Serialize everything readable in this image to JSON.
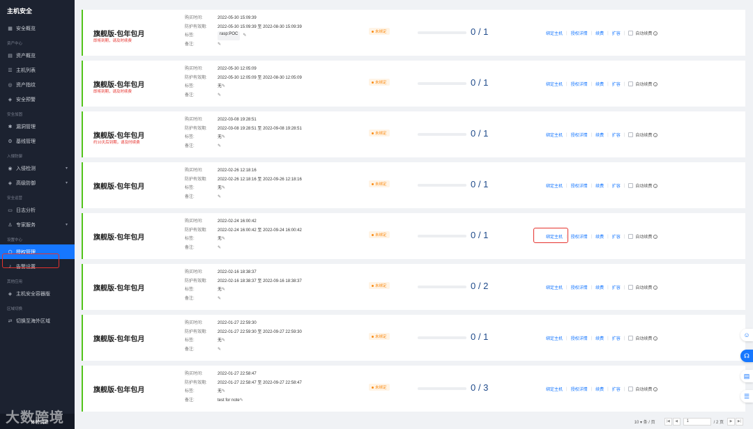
{
  "sidebar": {
    "brand": "主机安全",
    "items": [
      {
        "type": "item",
        "label": "安全概览",
        "icon": "grid-icon"
      },
      {
        "type": "group",
        "label": "资产中心"
      },
      {
        "type": "item",
        "label": "资产概览",
        "icon": "chart-icon"
      },
      {
        "type": "item",
        "label": "主机列表",
        "icon": "list-icon"
      },
      {
        "type": "item",
        "label": "资产指纹",
        "icon": "fingerprint-icon"
      },
      {
        "type": "item",
        "label": "安全预警",
        "icon": "shield-icon"
      },
      {
        "type": "group",
        "label": "安全加固"
      },
      {
        "type": "item",
        "label": "漏洞管理",
        "icon": "bug-icon"
      },
      {
        "type": "item",
        "label": "基线管理",
        "icon": "gear-icon"
      },
      {
        "type": "group",
        "label": "入侵防御"
      },
      {
        "type": "item",
        "label": "入侵检测",
        "icon": "radar-icon",
        "caret": true
      },
      {
        "type": "item",
        "label": "高级防御",
        "icon": "shield-icon",
        "caret": true
      },
      {
        "type": "group",
        "label": "安全运营"
      },
      {
        "type": "item",
        "label": "日志分析",
        "icon": "doc-icon"
      },
      {
        "type": "item",
        "label": "专家服务",
        "icon": "user-icon",
        "caret": true
      },
      {
        "type": "group",
        "label": "设置中心"
      },
      {
        "type": "item",
        "label": "授权管理",
        "icon": "key-icon",
        "active": true
      },
      {
        "type": "item",
        "label": "告警设置",
        "icon": "bell-icon"
      },
      {
        "type": "group",
        "label": "其他应用"
      },
      {
        "type": "item",
        "label": "主机安全容器版",
        "icon": "shield-icon"
      },
      {
        "type": "group",
        "label": "区域切换"
      },
      {
        "type": "item",
        "label": "切换至海外区域",
        "icon": "swap-icon"
      }
    ],
    "bottom_label": "体验调研",
    "watermark": "大数跨境"
  },
  "labels": {
    "purchase_time": "购买时间:",
    "protect_period": "防护有效期:",
    "tag": "标签:",
    "note": "备注:",
    "status": "未绑定",
    "bind_host": "绑定主机",
    "auth_detail": "授权详情",
    "renew": "续费",
    "expand": "扩容",
    "auto_renew": "自动续费",
    "to": "至"
  },
  "cards": [
    {
      "name": "旗舰版-包年包月",
      "warn": "即将到期，请及时续费",
      "purchase": "2022-05-30 15:09:39",
      "start": "2022-05-30 15:09:39",
      "end": "2022-08-30 15:09:39",
      "tag": "rasp:POC",
      "note": "",
      "used": 0,
      "total": 1,
      "count": "0 / 1"
    },
    {
      "name": "旗舰版-包年包月",
      "warn": "即将到期，请及时续费",
      "purchase": "2022-05-30 12:05:09",
      "start": "2022-05-30 12:05:09",
      "end": "2022-08-30 12:05:09",
      "tag": "无",
      "note": "",
      "used": 0,
      "total": 1,
      "count": "0 / 1"
    },
    {
      "name": "旗舰版-包年包月",
      "warn": "约10天后到期，请及时续费",
      "purchase": "2022-03-08 19:28:51",
      "start": "2022-03-08 19:28:51",
      "end": "2022-09-08 19:28:51",
      "tag": "无",
      "note": "",
      "used": 0,
      "total": 1,
      "count": "0 / 1"
    },
    {
      "name": "旗舰版-包年包月",
      "warn": "",
      "purchase": "2022-02-26 12:18:16",
      "start": "2022-02-26 12:18:16",
      "end": "2022-09-26 12:18:16",
      "tag": "无",
      "note": "",
      "used": 0,
      "total": 1,
      "count": "0 / 1"
    },
    {
      "name": "旗舰版-包年包月",
      "warn": "",
      "purchase": "2022-02-24 16:00:42",
      "start": "2022-02-24 16:00:42",
      "end": "2022-09-24 16:00:42",
      "tag": "无",
      "note": "",
      "used": 0,
      "total": 1,
      "count": "0 / 1",
      "highlight": true
    },
    {
      "name": "旗舰版-包年包月",
      "warn": "",
      "purchase": "2022-02-16 18:38:37",
      "start": "2022-02-16 18:38:37",
      "end": "2022-09-16 18:38:37",
      "tag": "无",
      "note": "",
      "used": 0,
      "total": 2,
      "count": "0 / 2"
    },
    {
      "name": "旗舰版-包年包月",
      "warn": "",
      "purchase": "2022-01-27 22:59:30",
      "start": "2022-01-27 22:59:30",
      "end": "2022-09-27 22:59:30",
      "tag": "无",
      "note": "",
      "used": 0,
      "total": 1,
      "count": "0 / 1"
    },
    {
      "name": "旗舰版-包年包月",
      "warn": "",
      "purchase": "2022-01-27 22:58:47",
      "start": "2022-01-27 22:58:47",
      "end": "2022-09-27 22:58:47",
      "tag": "无",
      "note": "test for note",
      "used": 0,
      "total": 3,
      "count": "0 / 3"
    }
  ],
  "pagination": {
    "page_size": "10 ▾ 条 / 页",
    "current": "1",
    "total_pages": "/ 2 页"
  },
  "floating": [
    "smile-icon",
    "headset-icon",
    "book-icon",
    "list-icon"
  ]
}
